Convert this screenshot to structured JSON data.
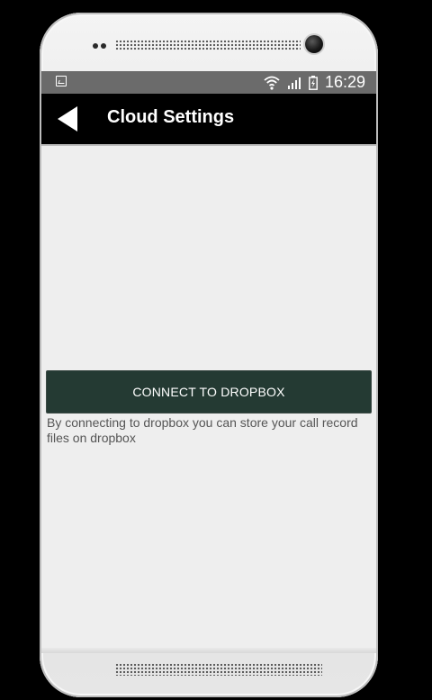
{
  "status_bar": {
    "time": "16:29"
  },
  "app_bar": {
    "title": "Cloud Settings"
  },
  "main": {
    "connect_button_label": "CONNECT TO DROPBOX",
    "description": "By connecting to dropbox you can store your call record files on dropbox"
  },
  "icons": {
    "back": "back-arrow-icon",
    "status_left": "image-notification-icon",
    "wifi": "wifi-icon",
    "signal": "signal-icon",
    "battery": "battery-charging-icon"
  },
  "colors": {
    "app_bar": "#000000",
    "status_bar": "#6b6b6b",
    "screen_background": "#eeeeee",
    "button_background": "#243a33",
    "button_text": "#ffffff",
    "description_text": "#555555"
  }
}
